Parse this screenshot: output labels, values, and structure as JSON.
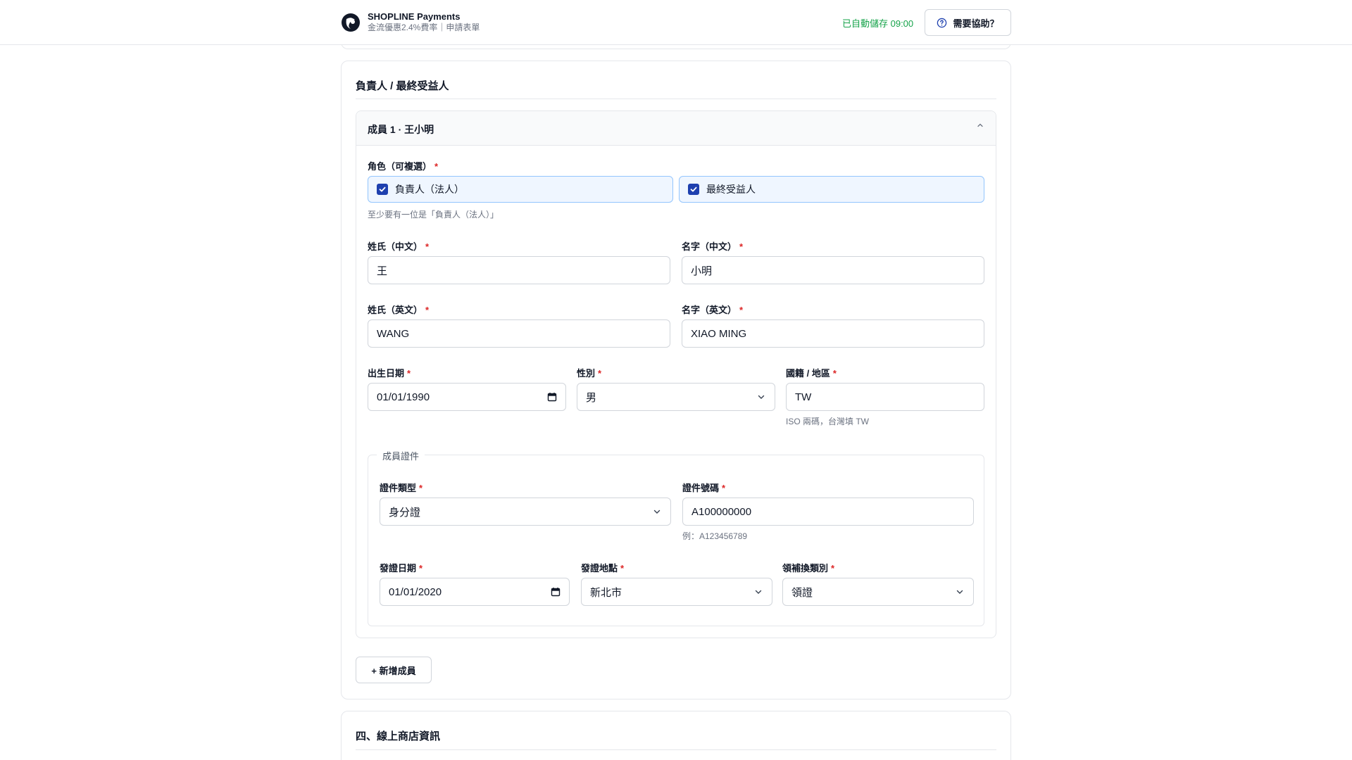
{
  "header": {
    "brand_title": "SHOPLINE Payments",
    "brand_subtitle": "金流優惠2.4%費率｜申請表單",
    "autosave": "已自動儲存 09:00",
    "help_label": "需要協助？"
  },
  "section": {
    "title": "負責人 / 最終受益人",
    "member": {
      "title": "成員 1 · 王小明",
      "roles_label": "角色（可複選）",
      "roles": [
        {
          "label": "負責人（法人）",
          "checked": true
        },
        {
          "label": "最終受益人",
          "checked": true
        }
      ],
      "roles_hint": "至少要有一位是「負責人（法人）」",
      "last_name_zh": {
        "label": "姓氏（中文）",
        "value": "王"
      },
      "first_name_zh": {
        "label": "名字（中文）",
        "value": "小明"
      },
      "last_name_en": {
        "label": "姓氏（英文）",
        "value": "WANG"
      },
      "first_name_en": {
        "label": "名字（英文）",
        "value": "XIAO MING"
      },
      "birth_date": {
        "label": "出生日期",
        "value": "01/01/1990"
      },
      "gender": {
        "label": "性別",
        "value": "男"
      },
      "nationality": {
        "label": "國籍 / 地區",
        "value": "TW",
        "hint": "ISO 兩碼，台灣填 TW"
      },
      "id_doc": {
        "legend": "成員證件",
        "type": {
          "label": "證件類型",
          "value": "身分證"
        },
        "number": {
          "label": "證件號碼",
          "value": "A100000000",
          "hint": "例：A123456789"
        },
        "issue_date": {
          "label": "發證日期",
          "value": "01/01/2020"
        },
        "issue_place": {
          "label": "發證地點",
          "value": "新北市"
        },
        "issue_type": {
          "label": "領補換類別",
          "value": "領證"
        }
      }
    },
    "add_member_label": "+ 新增成員"
  },
  "next_section": {
    "title": "四、線上商店資訊"
  },
  "colors": {
    "accent": "#1e40af",
    "required": "#dc2626",
    "autosave": "#16a34a"
  }
}
